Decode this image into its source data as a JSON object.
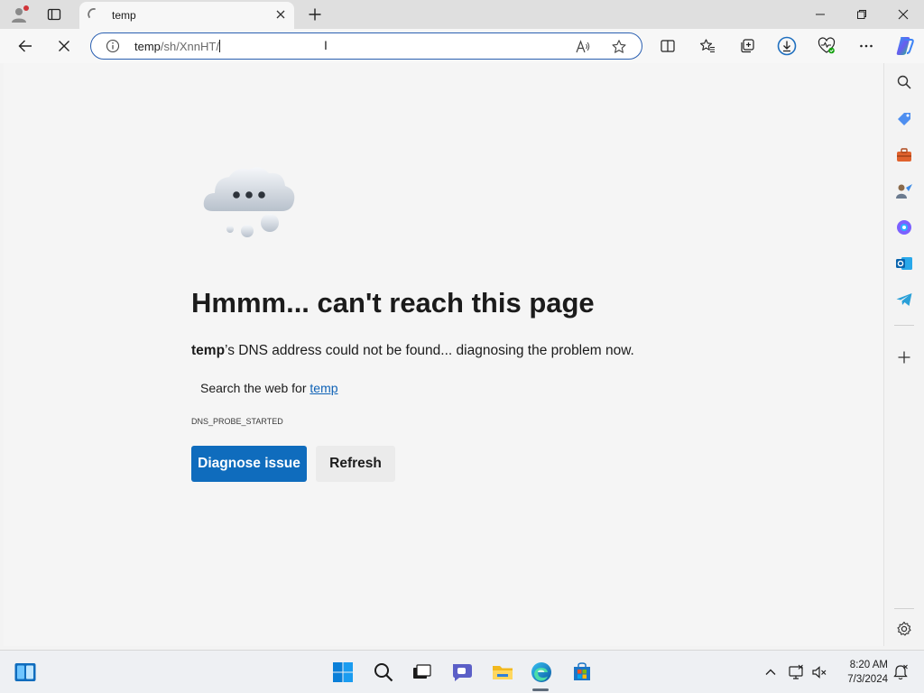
{
  "tab": {
    "title": "temp"
  },
  "address_bar": {
    "host": "temp",
    "path": "/sh/XnnHT/"
  },
  "error_page": {
    "heading": "Hmmm... can't reach this page",
    "host_bold": "temp",
    "description_rest": "’s DNS address could not be found... diagnosing the problem now.",
    "search_prefix": "Search the web for ",
    "search_link": "temp",
    "error_code": "DNS_PROBE_STARTED",
    "diagnose_button": "Diagnose issue",
    "refresh_button": "Refresh"
  },
  "taskbar": {
    "time": "8:20 AM",
    "date": "7/3/2024"
  },
  "colors": {
    "primary_button": "#0f6cbd",
    "link": "#0f62b6",
    "address_border": "#2a5fb1"
  },
  "icons": {
    "tabstrip": [
      "profile-icon",
      "tab-actions-icon",
      "loading-spinner-icon",
      "close-tab-icon",
      "new-tab-icon",
      "minimize-icon",
      "restore-icon",
      "close-window-icon"
    ],
    "toolbar": [
      "back-icon",
      "stop-icon",
      "site-info-icon",
      "read-aloud-icon",
      "favorite-star-icon",
      "split-screen-icon",
      "favorites-icon",
      "collections-icon",
      "downloads-icon",
      "browser-essentials-icon",
      "more-icon",
      "copilot-icon"
    ],
    "sidebar": [
      "search-icon",
      "shopping-icon",
      "tools-icon",
      "games-icon",
      "office-icon",
      "outlook-icon",
      "telegram-icon",
      "add-icon",
      "settings-icon"
    ],
    "taskbar": [
      "widgets-icon",
      "start-icon",
      "search-icon",
      "task-view-icon",
      "chat-icon",
      "file-explorer-icon",
      "edge-icon",
      "store-icon",
      "chevron-up-icon",
      "network-icon",
      "volume-muted-icon",
      "notification-icon"
    ]
  }
}
